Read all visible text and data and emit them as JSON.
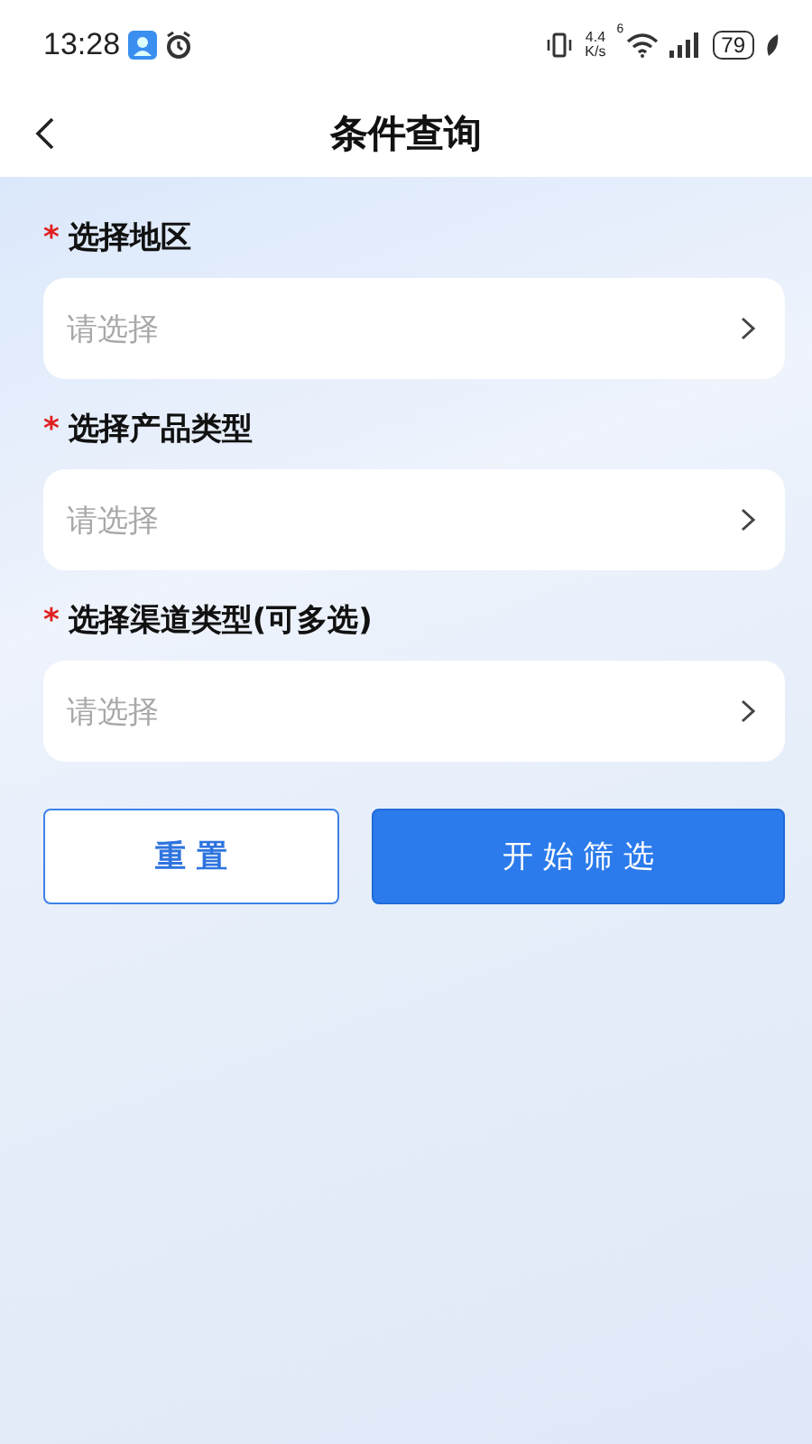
{
  "status_bar": {
    "time": "13:28",
    "net_speed_value": "4.4",
    "net_speed_unit": "K/s",
    "wifi_badge": "6",
    "battery": "79"
  },
  "header": {
    "title": "条件查询"
  },
  "fields": [
    {
      "label": "选择地区",
      "mark": "*",
      "required": true,
      "placeholder": "请选择"
    },
    {
      "label": "选择产品类型",
      "mark": "*",
      "required": true,
      "placeholder": "请选择"
    },
    {
      "label": "选择渠道类型(可多选)",
      "mark": "*",
      "required": true,
      "placeholder": "请选择"
    }
  ],
  "buttons": [
    {
      "label": "重 置",
      "kind": "outline"
    },
    {
      "label": "开 始 筛 选",
      "kind": "primary"
    }
  ]
}
